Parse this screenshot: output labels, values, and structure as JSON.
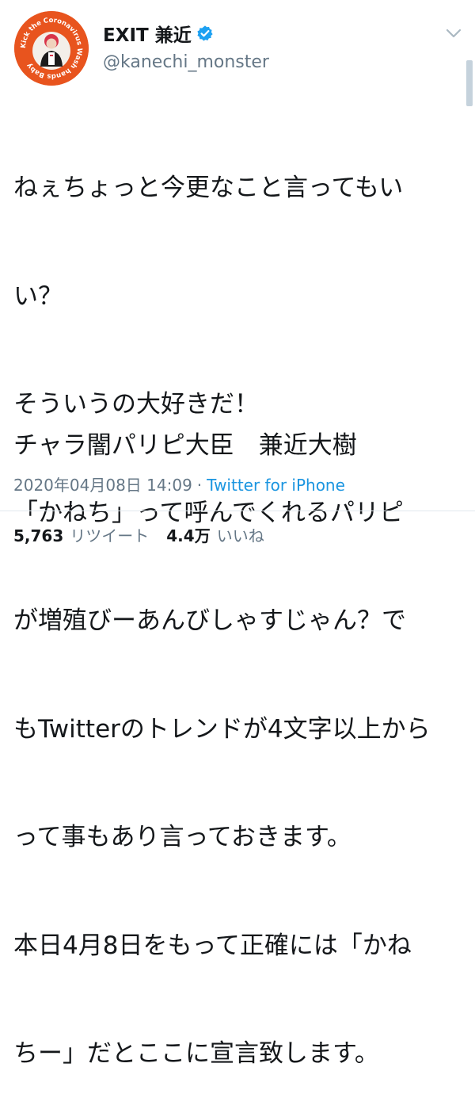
{
  "user": {
    "display_name": "EXIT 兼近",
    "handle": "@kanechi_monster",
    "avatar_text": "Kick the Coronavirus Wash hands Baby"
  },
  "tweet": {
    "lines": [
      "ねぇちょっと今更なこと言ってもい",
      "い？",
      "そういうの大好きだ！",
      "「かねち」って呼んでくれるパリピ",
      "が増殖びーあんびしゃすじゃん？で",
      "もTwitterのトレンドが4文字以上から",
      "って事もあり言っておきます。",
      "本日4月8日をもって正確には「かね",
      "ちー」だとここに宣言致します。"
    ],
    "signature": "チャラ闇パリピ大臣　兼近大樹",
    "timestamp": "2020年04月08日 14:09",
    "separator": "·",
    "source": "Twitter for iPhone"
  },
  "stats": {
    "retweets_count": "5,763",
    "retweets_label": "リツイート",
    "likes_count": "4.4万",
    "likes_label": "いいね"
  },
  "colors": {
    "text": "#14171a",
    "secondary": "#657786",
    "link": "#1b95e0",
    "verified": "#1da1f2",
    "avatar_ring": "#e8541e"
  },
  "icons": {
    "verified": "verified-badge-icon",
    "caret": "chevron-down-icon"
  }
}
